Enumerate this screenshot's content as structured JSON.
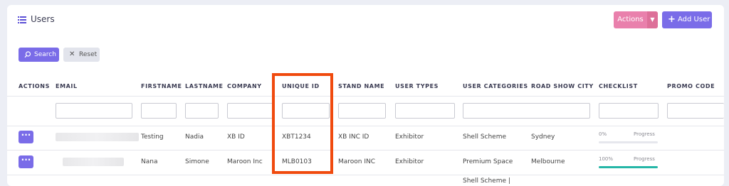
{
  "header": {
    "title": "Users",
    "actions_label": "Actions",
    "add_user_label": "Add User"
  },
  "filters": {
    "search_label": "Search",
    "reset_label": "Reset"
  },
  "table": {
    "columns": [
      "ACTIONS",
      "EMAIL",
      "FIRSTNAME",
      "LASTNAME",
      "COMPANY",
      "UNIQUE ID",
      "STAND NAME",
      "USER TYPES",
      "USER CATEGORIES",
      "ROAD SHOW CITY",
      "CHECKLIST",
      "PROMO CODE"
    ],
    "progress_label": "Progress",
    "rows": [
      {
        "firstname": "Testing",
        "lastname": "Nadia",
        "company": "XB ID",
        "unique_id": "XBT1234",
        "stand_name": "XB INC ID",
        "user_type": "Exhibitor",
        "user_category": "Shell Scheme",
        "city": "Sydney",
        "checklist_pct": "0%",
        "checklist_value": 0
      },
      {
        "firstname": "Nana",
        "lastname": "Simone",
        "company": "Maroon Inc",
        "unique_id": "MLB0103",
        "stand_name": "Maroon INC",
        "user_type": "Exhibitor",
        "user_category": "Premium Space",
        "city": "Melbourne",
        "checklist_pct": "100%",
        "checklist_value": 100
      },
      {
        "user_category": "Shell Scheme |"
      }
    ]
  },
  "colors": {
    "primary": "#7a6ce8",
    "actions": "#e980ac",
    "highlight": "#f04a0e",
    "progress": "#25b6a7"
  },
  "icons": {
    "title": "list-icon",
    "search": "search-icon",
    "reset": "close-icon",
    "add": "plus-icon",
    "caret": "chevron-down-icon",
    "row_actions": "ellipsis-icon"
  }
}
